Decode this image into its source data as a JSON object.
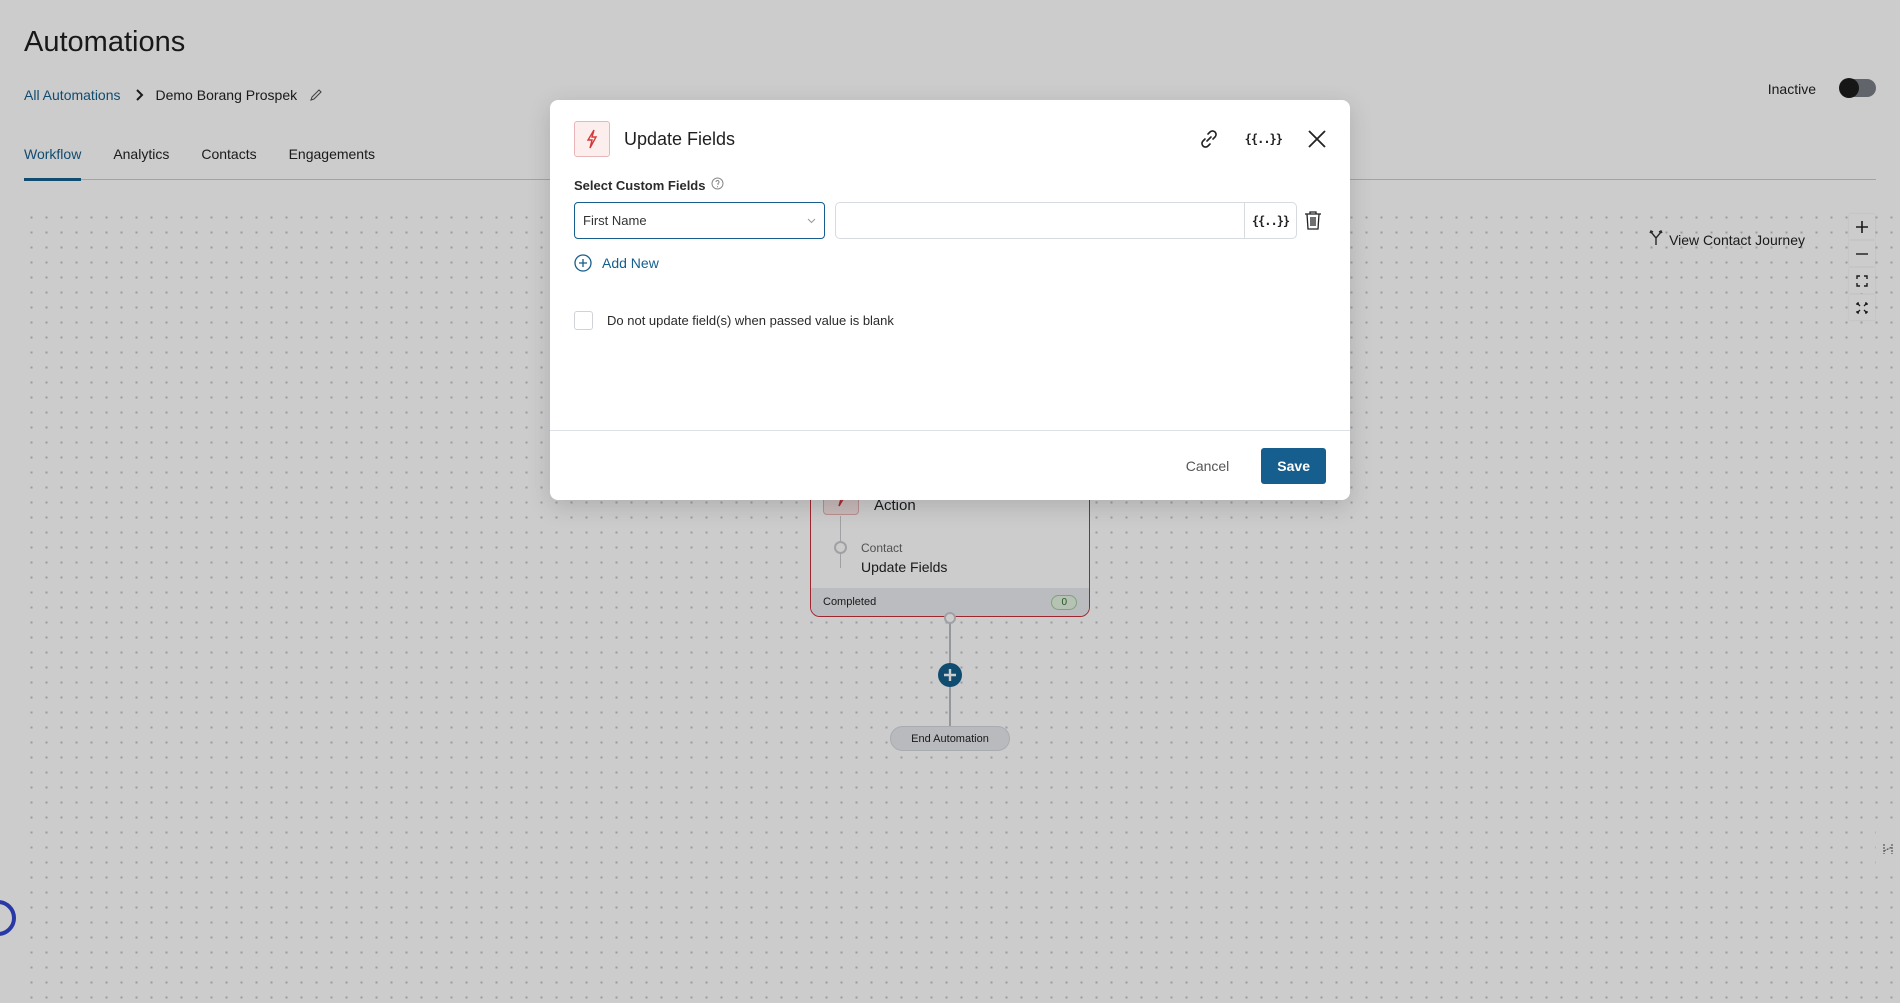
{
  "header": {
    "title": "Automations",
    "breadcrumb": {
      "root": "All Automations",
      "current": "Demo Borang Prospek"
    },
    "status_label": "Inactive",
    "active": false
  },
  "tabs": [
    {
      "label": "Workflow",
      "active": true
    },
    {
      "label": "Analytics",
      "active": false
    },
    {
      "label": "Contacts",
      "active": false
    },
    {
      "label": "Engagements",
      "active": false
    }
  ],
  "canvas": {
    "journey_label": "View Contact Journey",
    "zoom_controls": [
      "zoom-in",
      "zoom-out",
      "fit-view",
      "fullscreen"
    ],
    "node": {
      "title": "Action",
      "category": "Contact",
      "name": "Update Fields",
      "footer_label": "Completed",
      "count": "0"
    },
    "end_label": "End Automation"
  },
  "modal": {
    "title": "Update Fields",
    "field_label": "Select Custom Fields",
    "rows": [
      {
        "field": "First Name",
        "value": "",
        "merge_tag_label": "{{..}}"
      }
    ],
    "merge_tag_label": "{{..}}",
    "add_new_label": "Add New",
    "checkbox_label": "Do not update field(s) when passed value is blank",
    "checkbox_checked": false,
    "cancel_label": "Cancel",
    "save_label": "Save"
  },
  "colors": {
    "accent": "#155e8d",
    "node_border": "#c9303a",
    "icon_red": "#d33a3a"
  }
}
